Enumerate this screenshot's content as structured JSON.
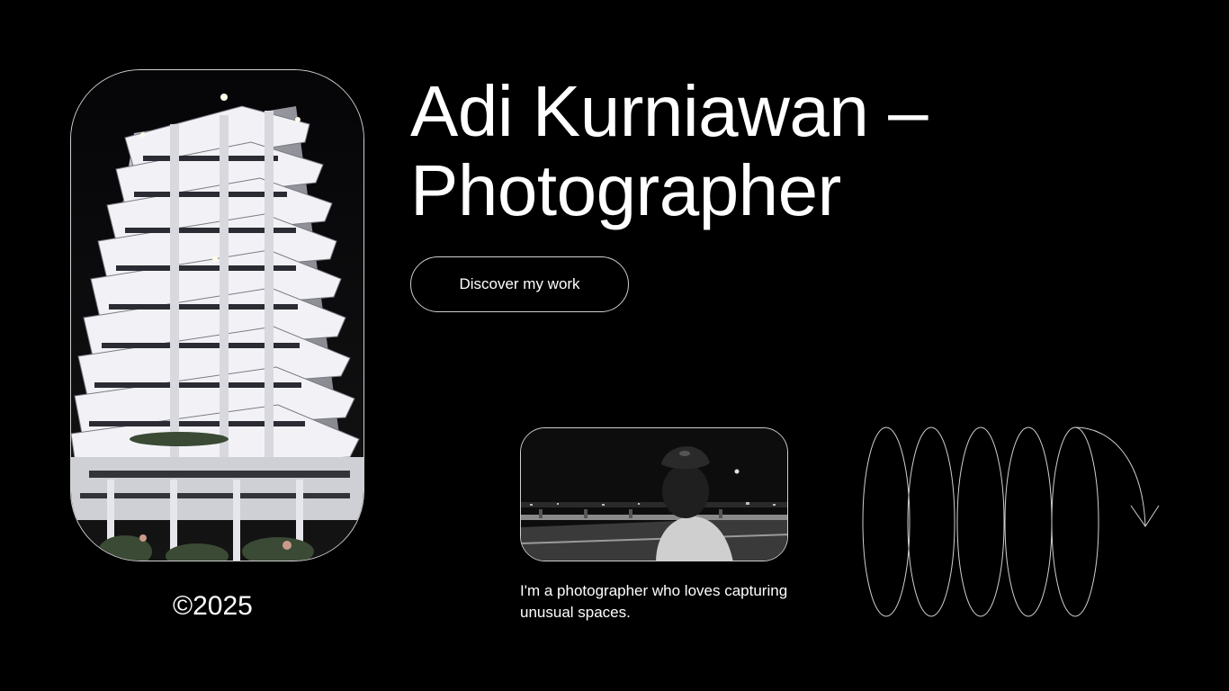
{
  "header": {
    "title_line1": "Adi Kurniawan –",
    "title_line2": "Photographer"
  },
  "cta": {
    "label": "Discover my work"
  },
  "footer": {
    "copyright": "©2025"
  },
  "about": {
    "bio": "I'm a photographer who loves capturing unusual spaces."
  },
  "icons": {
    "decoration": "spiral-arrow-icon"
  },
  "colors": {
    "background": "#000000",
    "text": "#ffffff",
    "outline": "#cfcfcf"
  }
}
